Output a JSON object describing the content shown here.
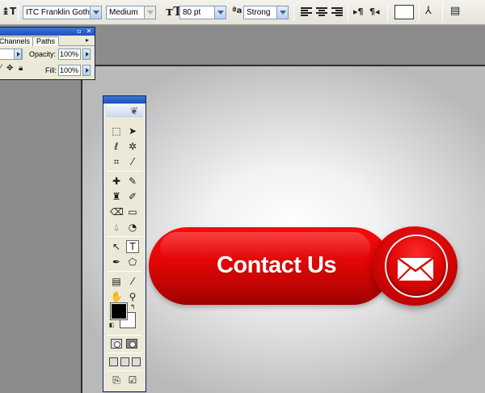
{
  "options_bar": {
    "font_family": "ITC Franklin Gothic",
    "font_style": "Medium",
    "font_size": "80 pt",
    "anti_alias": "Strong",
    "text_color": "#ffffff"
  },
  "layers_panel": {
    "tabs": [
      "Channels",
      "Paths"
    ],
    "opacity_label": "Opacity:",
    "opacity_value": "100%",
    "fill_label": "Fill:",
    "fill_value": "100%"
  },
  "tools_palette": {
    "foreground_color": "#000000",
    "background_color": "#ffffff"
  },
  "canvas": {
    "button_label": "Contact Us",
    "button_color": "#e20606",
    "icon": "envelope-icon"
  }
}
